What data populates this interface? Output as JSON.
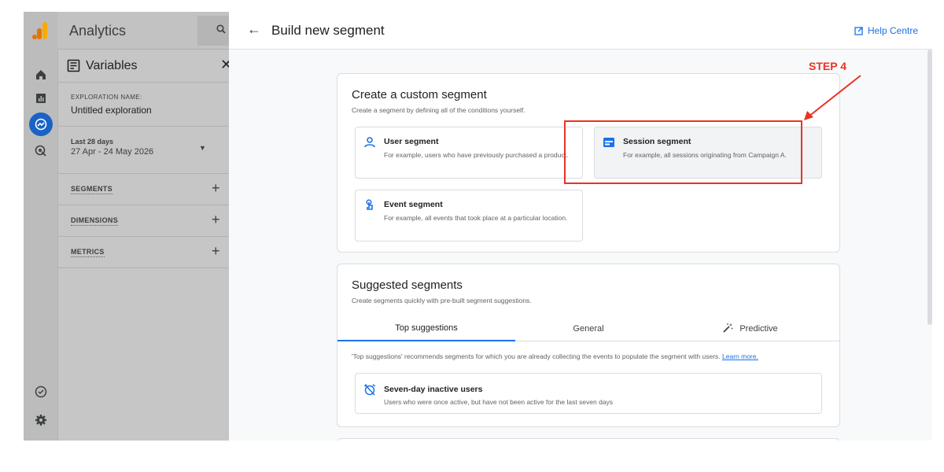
{
  "app": {
    "title": "Analytics",
    "search_icon": "search-icon"
  },
  "rail": {
    "icons": [
      "home-icon",
      "reports-icon",
      "explore-icon",
      "advertising-icon",
      "check-circle-icon",
      "settings-icon"
    ]
  },
  "variables": {
    "title": "Variables",
    "exploration_label": "EXPLORATION NAME:",
    "exploration_name": "Untitled exploration",
    "date_label": "Last 28 days",
    "date_range": "27 Apr - 24 May 2026",
    "sections": [
      "SEGMENTS",
      "DIMENSIONS",
      "METRICS"
    ]
  },
  "dialog": {
    "title": "Build new segment",
    "help": "Help Centre",
    "custom": {
      "heading": "Create a custom segment",
      "subheading": "Create a segment by defining all of the conditions yourself.",
      "options": [
        {
          "title": "User segment",
          "desc": "For example, users who have previously purchased a product.",
          "icon": "user-icon"
        },
        {
          "title": "Session segment",
          "desc": "For example, all sessions originating from Campaign A.",
          "icon": "session-icon"
        },
        {
          "title": "Event segment",
          "desc": "For example, all events that took place at a particular location.",
          "icon": "event-icon"
        }
      ]
    },
    "suggested": {
      "heading": "Suggested segments",
      "subheading": "Create segments quickly with pre-built segment suggestions.",
      "tabs": [
        "Top suggestions",
        "General",
        "Predictive"
      ],
      "active_tab": "Top suggestions",
      "note": "'Top suggestions' recommends segments for which you are already collecting the events to populate the segment with users.",
      "learn_more": "Learn more.",
      "item": {
        "title": "Seven-day inactive users",
        "desc": "Users who were once active, but have not been active for the last seven days"
      }
    }
  },
  "annotation": {
    "label": "STEP 4",
    "color": "#ea3323"
  }
}
